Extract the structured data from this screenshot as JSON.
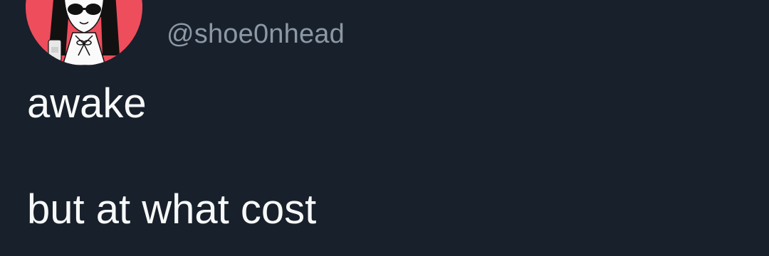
{
  "author": {
    "handle": "@shoe0nhead",
    "avatar_icon": "anime-girl-avatar-icon",
    "avatar_bg": "#ee4d5c"
  },
  "tweet": {
    "lines": [
      "awake",
      "",
      "but at what cost"
    ]
  },
  "colors": {
    "background": "#18202b",
    "text": "#f7f9f9",
    "handle": "#8b98a5"
  }
}
